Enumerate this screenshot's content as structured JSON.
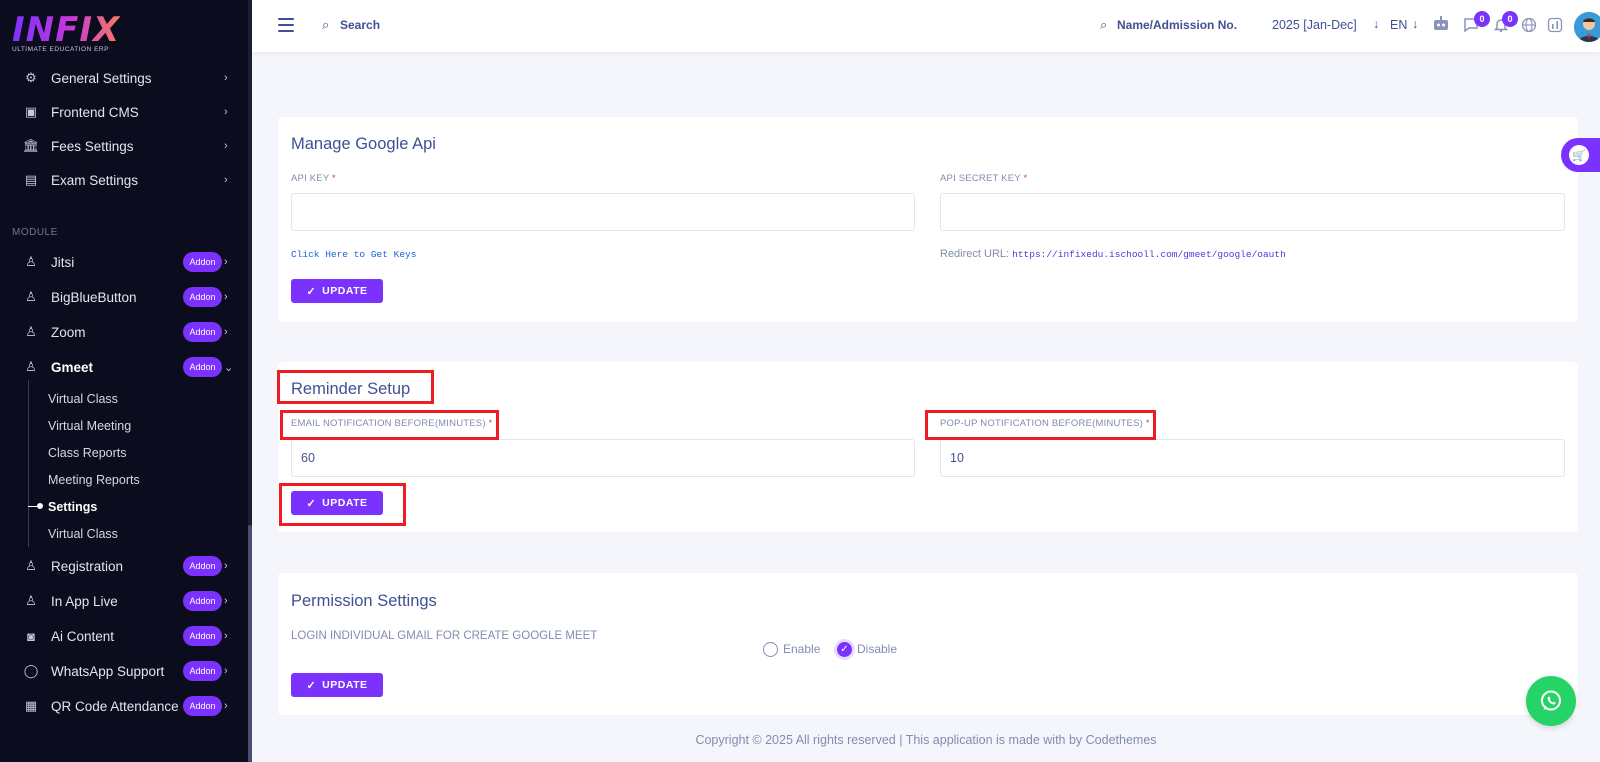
{
  "brand": {
    "logo": "INFIX",
    "tagline": "ULTIMATE EDUCATION ERP"
  },
  "sidebar": {
    "top_items": [
      {
        "label": "General Settings",
        "icon": "gears-icon"
      },
      {
        "label": "Frontend CMS",
        "icon": "monitor-icon"
      },
      {
        "label": "Fees Settings",
        "icon": "bank-icon"
      },
      {
        "label": "Exam Settings",
        "icon": "book-icon"
      }
    ],
    "module_heading": "MODULE",
    "addon_label": "Addon",
    "modules": [
      {
        "label": "Jitsi"
      },
      {
        "label": "BigBlueButton"
      },
      {
        "label": "Zoom"
      },
      {
        "label": "Gmeet"
      }
    ],
    "gmeet_sub": [
      "Virtual Class",
      "Virtual Meeting",
      "Class Reports",
      "Meeting Reports",
      "Settings",
      "Virtual Class"
    ],
    "more_modules": [
      {
        "label": "Registration"
      },
      {
        "label": "In App Live"
      },
      {
        "label": "Ai Content"
      },
      {
        "label": "WhatsApp Support"
      },
      {
        "label": "QR Code Attendance"
      }
    ]
  },
  "header": {
    "search_placeholder": "Search",
    "student_search_placeholder": "Name/Admission No.",
    "academic_year": "2025 [Jan-Dec]",
    "language": "EN",
    "chat_count": "0",
    "notification_count": "0"
  },
  "google_api": {
    "title": "Manage Google Api",
    "api_key_label": "API KEY",
    "api_key_value": "",
    "api_secret_label": "API SECRET KEY",
    "api_secret_value": "",
    "get_keys_link": "Click Here to Get Keys",
    "redirect_label": "Redirect URL:",
    "redirect_url": "https://infixedu.ischooll.com/gmeet/google/oauth",
    "update_label": "UPDATE"
  },
  "reminder": {
    "title": "Reminder Setup",
    "email_label": "EMAIL NOTIFICATION BEFORE(MINUTES)",
    "email_value": "60",
    "popup_label": "POP-UP NOTIFICATION BEFORE(MINUTES)",
    "popup_value": "10",
    "update_label": "UPDATE"
  },
  "permission": {
    "title": "Permission Settings",
    "login_label": "LOGIN INDIVIDUAL GMAIL FOR CREATE GOOGLE MEET",
    "enable_label": "Enable",
    "disable_label": "Disable",
    "selected": "Disable",
    "update_label": "UPDATE"
  },
  "required_mark": "*",
  "footer": "Copyright © 2025 All rights reserved | This application is made with by Codethemes",
  "colors": {
    "accent": "#7c32ff",
    "sidebar_bg": "#0b0c1e",
    "highlight": "#ee1c24",
    "text": "#415094"
  }
}
